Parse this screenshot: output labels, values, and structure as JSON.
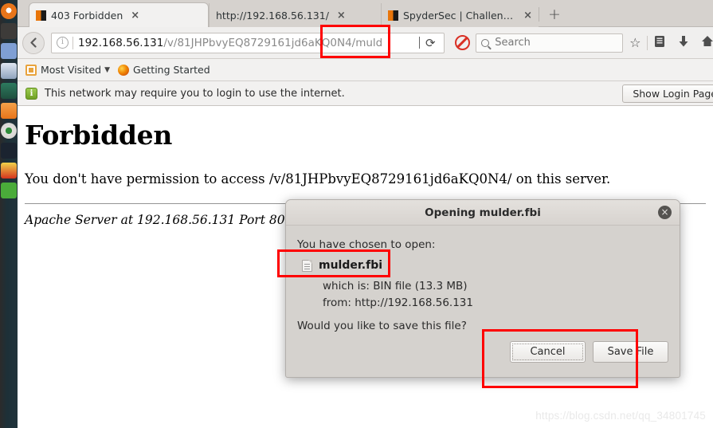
{
  "launcher": {
    "items": [
      {
        "name": "ubuntu-software-icon",
        "color": "#e8751a"
      },
      {
        "name": "files-icon",
        "color": "#3d3b39"
      },
      {
        "name": "text-editor-icon",
        "color": "#7f9fd4"
      },
      {
        "name": "security-shield-icon",
        "color": "#b8c4d6"
      },
      {
        "name": "terminal-cactus-icon",
        "color": "#2d7a5f"
      },
      {
        "name": "firefox-icon",
        "color": "#e8751a"
      },
      {
        "name": "media-player-icon",
        "color": "#dcdcdc"
      },
      {
        "name": "dark-app-icon",
        "color": "#1b2430"
      },
      {
        "name": "warning-app-icon",
        "color": "#e8c21a"
      },
      {
        "name": "green-app-icon",
        "color": "#4aab3a"
      }
    ]
  },
  "browser": {
    "tabs": [
      {
        "title": "403 Forbidden",
        "favicon": "orange-black-favicon",
        "active": true,
        "close_label": "×"
      },
      {
        "title": "http://192.168.56.131/",
        "favicon": "none",
        "active": false,
        "close_label": "×"
      },
      {
        "title": "SpyderSec | Challenge",
        "favicon": "orange-black-favicon",
        "active": false,
        "close_label": "×"
      }
    ],
    "new_tab_label": "+",
    "toolbar": {
      "back_label": "←",
      "reload_label": "⟳",
      "url_host": "192.168.56.131",
      "url_path": "/v/81JHPbvyEQ8729161jd6aKQ0N4/muld",
      "url_full": "192.168.56.131/v/81JHPbvyEQ8729161jd6aKQ0N4/muld",
      "search_placeholder": "Search",
      "icons": [
        {
          "name": "bookmark-star-icon",
          "glyph": "☆"
        },
        {
          "name": "library-icon",
          "glyph": "▤"
        },
        {
          "name": "downloads-icon",
          "glyph": "⬇"
        },
        {
          "name": "home-icon",
          "glyph": "⌂"
        },
        {
          "name": "pocket-icon",
          "glyph": "▽"
        }
      ]
    },
    "bookmarks": [
      {
        "label": "Most Visited",
        "icon": "most-visited-icon",
        "has_chevron": true
      },
      {
        "label": "Getting Started",
        "icon": "firefox-icon",
        "has_chevron": false
      }
    ],
    "notification": {
      "icon": "info-icon",
      "message": "This network may require you to login to use the internet.",
      "button_label": "Show Login Page"
    }
  },
  "page": {
    "heading": "Forbidden",
    "body_text": "You don't have permission to access /v/81JHPbvyEQ8729161jd6aKQ0N4/ on this server.",
    "footer_text": "Apache Server at 192.168.56.131 Port 80",
    "watermark": "https://blog.csdn.net/qq_34801745"
  },
  "dialog": {
    "title": "Opening mulder.fbi",
    "close_label": "×",
    "chosen_label": "You have chosen to open:",
    "file_name": "mulder.fbi",
    "file_icon": "bin-file-icon",
    "which_is": "which is: BIN file (13.3 MB)",
    "from": "from: http://192.168.56.131",
    "question": "Would you like to save this file?",
    "cancel_label": "Cancel",
    "save_label": "Save File"
  },
  "annotations": {
    "accent_color": "#ff0000",
    "boxes": [
      {
        "name": "url-suffix-highlight"
      },
      {
        "name": "filename-highlight"
      },
      {
        "name": "dialog-buttons-highlight"
      }
    ]
  }
}
